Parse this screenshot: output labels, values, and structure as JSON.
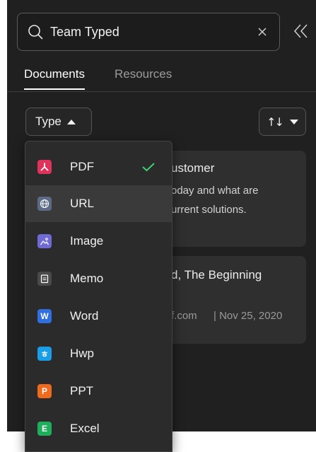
{
  "search": {
    "value": "Team Typed",
    "placeholder": ""
  },
  "tabs": [
    {
      "label": "Documents",
      "active": true
    },
    {
      "label": "Resources",
      "active": false
    }
  ],
  "filter": {
    "type_label": "Type",
    "sort_icon": "sort-arrows-icon"
  },
  "cards": [
    {
      "title": "ustomer",
      "line2": "oday and what are",
      "line3": "urrent solutions."
    },
    {
      "title": "d, The Beginning",
      "meta_source": "f.com",
      "meta_date": "| Nov 25, 2020"
    }
  ],
  "dropdown": {
    "options": [
      {
        "label": "PDF",
        "icon": "pdf-icon",
        "color": "#e0335a",
        "selected": true
      },
      {
        "label": "URL",
        "icon": "globe-icon",
        "color": "#5d6b86",
        "selected": false,
        "hover": true
      },
      {
        "label": "Image",
        "icon": "image-icon",
        "color": "#6f6ad6",
        "selected": false
      },
      {
        "label": "Memo",
        "icon": "memo-icon",
        "color": "#4a4a4a",
        "selected": false
      },
      {
        "label": "Word",
        "icon": "word-icon",
        "glyph": "W",
        "color": "#2f6fe0",
        "selected": false
      },
      {
        "label": "Hwp",
        "icon": "hwp-icon",
        "glyph": "ㅎ",
        "color": "#1a9ee8",
        "selected": false
      },
      {
        "label": "PPT",
        "icon": "ppt-icon",
        "glyph": "P",
        "color": "#f06a1d",
        "selected": false
      },
      {
        "label": "Excel",
        "icon": "excel-icon",
        "glyph": "E",
        "color": "#1fae5c",
        "selected": false
      }
    ]
  },
  "colors": {
    "check": "#3ecf6e"
  }
}
